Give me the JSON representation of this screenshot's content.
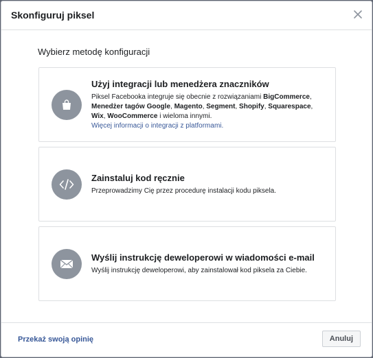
{
  "dialog": {
    "title": "Skonfiguruj piksel"
  },
  "section": {
    "title": "Wybierz metodę konfiguracji"
  },
  "options": [
    {
      "icon": "shopping-bag-icon",
      "heading": "Użyj integracji lub menedżera znaczników",
      "desc_parts": [
        {
          "text": "Piksel Facebooka integruje się obecnie z rozwiązaniami ",
          "bold": false
        },
        {
          "text": "BigCommerce",
          "bold": true
        },
        {
          "text": ", ",
          "bold": false
        },
        {
          "text": "Menedżer tagów Google",
          "bold": true
        },
        {
          "text": ", ",
          "bold": false
        },
        {
          "text": "Magento",
          "bold": true
        },
        {
          "text": ", ",
          "bold": false
        },
        {
          "text": "Segment",
          "bold": true
        },
        {
          "text": ", ",
          "bold": false
        },
        {
          "text": "Shopify",
          "bold": true
        },
        {
          "text": ", ",
          "bold": false
        },
        {
          "text": "Squarespace",
          "bold": true
        },
        {
          "text": ", ",
          "bold": false
        },
        {
          "text": "Wix",
          "bold": true
        },
        {
          "text": ", ",
          "bold": false
        },
        {
          "text": "WooCommerce",
          "bold": true
        },
        {
          "text": " i wieloma innymi.",
          "bold": false
        }
      ],
      "link": "Więcej informacji o integracji z platformami."
    },
    {
      "icon": "code-icon",
      "heading": "Zainstaluj kod ręcznie",
      "desc": "Przeprowadzimy Cię przez procedurę instalacji kodu piksela."
    },
    {
      "icon": "envelope-icon",
      "heading": "Wyślij instrukcję deweloperowi w wiadomości e-mail",
      "desc": "Wyślij instrukcję deweloperowi, aby zainstalował kod piksela za Ciebie."
    }
  ],
  "footer": {
    "feedback": "Przekaż swoją opinię",
    "cancel": "Anuluj"
  },
  "colors": {
    "icon_bg": "#8d949e",
    "link": "#385898",
    "border": "#dddfe2"
  }
}
